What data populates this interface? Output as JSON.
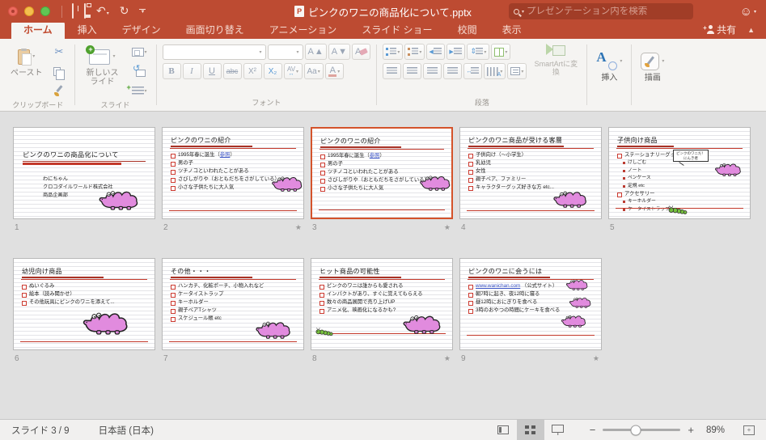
{
  "titlebar": {
    "document_title": "ピンクのワニの商品化について.pptx",
    "search_placeholder": "プレゼンテーション内を検索",
    "doc_icon_letter": "P"
  },
  "header": {
    "tabs": [
      "ホーム",
      "挿入",
      "デザイン",
      "画面切り替え",
      "アニメーション",
      "スライド ショー",
      "校閲",
      "表示"
    ],
    "share_label": "共有"
  },
  "ribbon": {
    "paste_label": "ペースト",
    "group_clipboard": "クリップボード",
    "new_slide_label": "新しいスライド",
    "group_slides": "スライド",
    "group_font": "フォント",
    "group_paragraph": "段落",
    "smartart_label": "SmartArtに変換",
    "insert_label": "挿入",
    "draw_label": "描画",
    "font_buttons": {
      "bold": "B",
      "italic": "I",
      "underline": "U",
      "strikethrough": "abc",
      "superscript": "X²",
      "subscript": "X₂",
      "spacing": "AV",
      "change_case": "Aa",
      "font_color": "A",
      "grow": "A",
      "shrink": "A",
      "clear": "A"
    }
  },
  "slides": [
    {
      "num": "1",
      "title": "ピンクのワニの商品化について",
      "lines": [
        "わにちゃん",
        "クロコダイルワールド株式会社",
        "商品企画部"
      ]
    },
    {
      "num": "2",
      "title": "ピンクのワニの紹介",
      "b0": {
        "pre": "1995年春に誕生（",
        "link": "参照",
        "post": "）"
      },
      "bullets": [
        "男の子",
        "ツチノコといわれたことがある",
        "さびしがりや（おともだちをさがしている）",
        "小さな子供たちに大人気"
      ]
    },
    {
      "num": "3",
      "title": "ピンクのワニの紹介",
      "b0": {
        "pre": "1995年春に誕生（",
        "link": "参照",
        "post": "）"
      },
      "bullets": [
        "男の子",
        "ツチノコといわれたことがある",
        "さびしがりや（おともだちをさがしている）",
        "小さな子供たちに大人気"
      ]
    },
    {
      "num": "4",
      "title": "ピンクのワニ商品が受ける客層",
      "bullets": [
        "子供向け（～小学生）",
        "乳幼児",
        "女性",
        "親子ペア、ファミリー",
        "キャラクターグッズ好きな方 etc..."
      ]
    },
    {
      "num": "5",
      "title": "子供向け商品",
      "items": [
        {
          "t": "ステーショナリーグッズ",
          "lv": 1
        },
        {
          "t": "けしごむ",
          "lv": 2
        },
        {
          "t": "ノート",
          "lv": 2
        },
        {
          "t": "ペンケース",
          "lv": 2
        },
        {
          "t": "定規 etc",
          "lv": 2
        },
        {
          "t": "アクセサリー",
          "lv": 1
        },
        {
          "t": "キーホルダー",
          "lv": 2
        },
        {
          "t": "ケータイストラップ",
          "lv": 2
        }
      ],
      "callout_line1": "ピンクのワニだ！",
      "callout_line2": "にんき者"
    },
    {
      "num": "6",
      "title": "幼児向け商品",
      "bullets": [
        "ぬいぐるみ",
        "絵本（読み聞かせ）",
        "その他玩具にピンクのワニを添えて..."
      ]
    },
    {
      "num": "7",
      "title": "その他・・・",
      "bullets": [
        "ハンカチ、化粧ポーチ、小物入れなど",
        "ケータイストラップ",
        "キーホルダー",
        "親子ペアTシャツ",
        "スケジュール帳 etc"
      ]
    },
    {
      "num": "8",
      "title": "ヒット商品の可能性",
      "bullets": [
        "ピンクのワニは誰からも愛される",
        "インパクトがあり、すぐに覚えてもらえる",
        "数々の商品展開で売り上げUP",
        "アニメ化、映画化になるかも?"
      ]
    },
    {
      "num": "9",
      "title": "ピンクのワニに会うには",
      "b0": {
        "link": "www.wanichan.com",
        "post": " （公式サイト）"
      },
      "bullets": [
        "朝7時に起き、夜12時に寝る",
        "昼12時におにぎりを食べる",
        "3時のおやつの時間にケーキを食べる"
      ]
    }
  ],
  "statusbar": {
    "slide_counter": "スライド 3 / 9",
    "language": "日本語 (日本)",
    "zoom_level": "89%"
  },
  "colors": {
    "titlebar_red": "#BD4B32",
    "selection_orange": "#D4532B",
    "slide_accent_red": "#C3392B",
    "croc_pink": "#E18BDE",
    "caterpillar_green": "#76C13D",
    "link_blue": "#3851C4"
  }
}
